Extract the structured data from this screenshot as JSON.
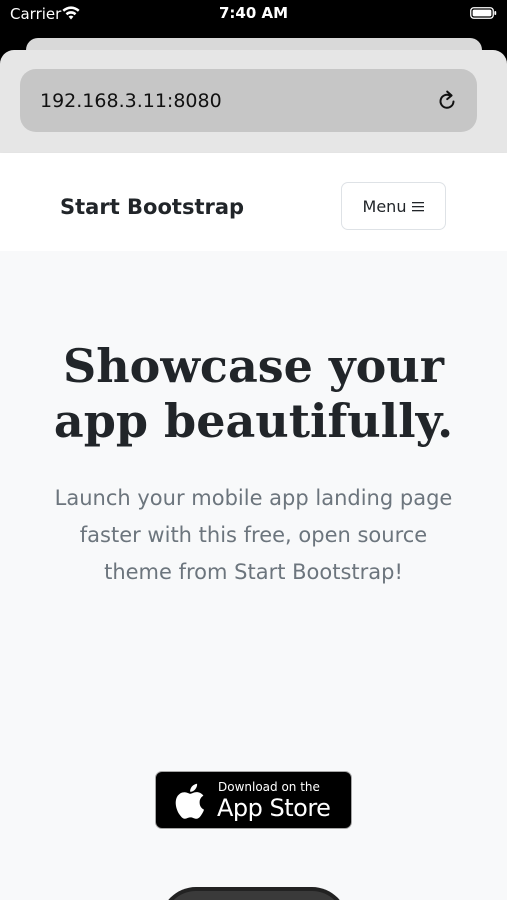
{
  "status_bar": {
    "carrier": "Carrier",
    "time": "7:40 AM",
    "wifi_icon": "wifi-icon",
    "battery_icon": "battery-icon"
  },
  "browser": {
    "url": "192.168.3.11:8080",
    "reload_icon": "reload-icon"
  },
  "navbar": {
    "brand": "Start Bootstrap",
    "menu_label": "Menu",
    "menu_icon": "hamburger-icon"
  },
  "hero": {
    "title_line1": "Showcase your",
    "title_line2": "app beautifully.",
    "subtitle": "Launch your mobile app landing page faster with this free, open source theme from Start Bootstrap!",
    "badge": {
      "small_text": "Download on the",
      "large_text": "App Store",
      "icon": "apple-icon"
    }
  },
  "colors": {
    "status_bar_bg": "#000000",
    "chrome_bg": "#e6e6e6",
    "address_bar_bg": "#c6c6c6",
    "page_bg": "#f8f9fa",
    "heading": "#212529",
    "muted_text": "#6c757d"
  }
}
